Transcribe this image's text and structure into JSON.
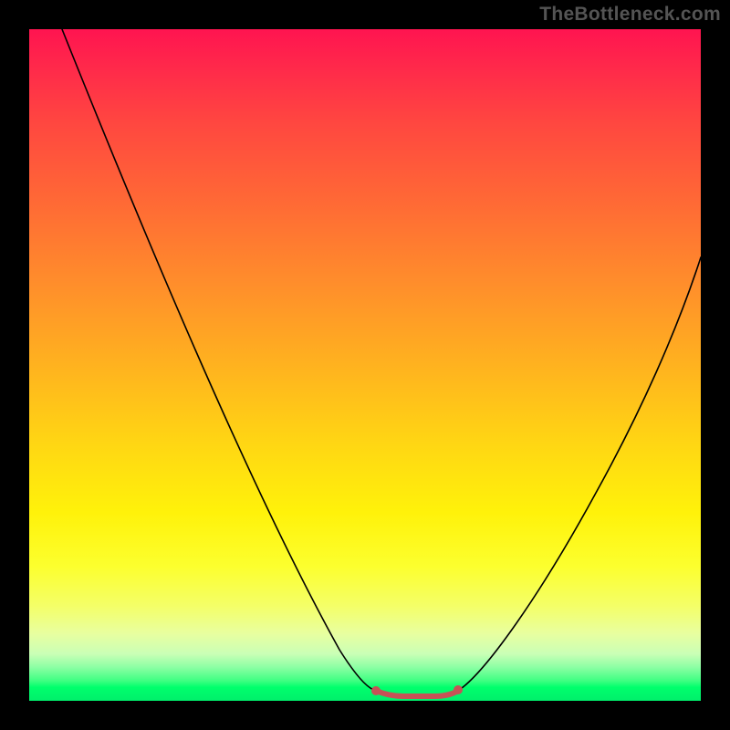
{
  "watermark": "TheBottleneck.com",
  "chart_data": {
    "type": "line",
    "title": "",
    "xlabel": "",
    "ylabel": "",
    "xlim": [
      0,
      100
    ],
    "ylim": [
      0,
      100
    ],
    "series": [
      {
        "name": "curve",
        "x": [
          5,
          10,
          15,
          20,
          25,
          30,
          35,
          40,
          45,
          48,
          51,
          55,
          58,
          61,
          64,
          70,
          76,
          82,
          88,
          94,
          99
        ],
        "values": [
          100,
          88,
          76,
          65,
          54,
          43,
          33,
          23,
          13,
          7,
          3,
          1,
          1,
          1,
          3,
          10,
          19,
          30,
          42,
          55,
          67
        ]
      }
    ],
    "flat_segment": {
      "x_start": 51,
      "x_end": 64,
      "y": 1.5
    },
    "background_gradient": {
      "axis": "y",
      "stops": [
        {
          "y": 100,
          "color": "#ff1450"
        },
        {
          "y": 60,
          "color": "#ff8e2b"
        },
        {
          "y": 30,
          "color": "#fff20a"
        },
        {
          "y": 8,
          "color": "#e8ffa0"
        },
        {
          "y": 0,
          "color": "#00ef6b"
        }
      ]
    }
  }
}
